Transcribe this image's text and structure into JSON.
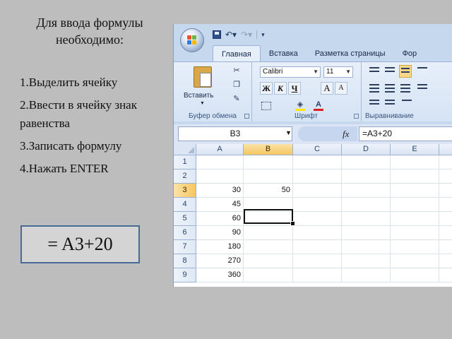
{
  "slide": {
    "title_line1": "Для ввода формулы",
    "title_line2": "необходимо:",
    "steps": [
      "1.Выделить ячейку",
      "2.Ввести  в ячейку знак равенства",
      "3.Записать формулу",
      "4.Нажать ENTER"
    ],
    "formula_example": "= A3+20"
  },
  "excel": {
    "tabs": [
      "Главная",
      "Вставка",
      "Разметка страницы",
      "Фор"
    ],
    "active_tab": "Главная",
    "clipboard": {
      "paste_label": "Вставить",
      "group_label": "Буфер обмена"
    },
    "font": {
      "font_name": "Calibri",
      "font_size": "11",
      "bold": "Ж",
      "italic": "К",
      "underline": "Ч",
      "grow": "A",
      "shrink": "A",
      "font_color": "A",
      "group_label": "Шрифт"
    },
    "alignment": {
      "group_label": "Выравнивание"
    },
    "name_box": "B3",
    "fx": "fx",
    "formula_bar": "=A3+20",
    "columns": [
      "A",
      "B",
      "C",
      "D",
      "E"
    ],
    "selected_column": "B",
    "rows": [
      {
        "num": "1",
        "A": "",
        "B": ""
      },
      {
        "num": "2",
        "A": "",
        "B": ""
      },
      {
        "num": "3",
        "A": "30",
        "B": "50"
      },
      {
        "num": "4",
        "A": "45",
        "B": ""
      },
      {
        "num": "5",
        "A": "60",
        "B": ""
      },
      {
        "num": "6",
        "A": "90",
        "B": ""
      },
      {
        "num": "7",
        "A": "180",
        "B": ""
      },
      {
        "num": "8",
        "A": "270",
        "B": ""
      },
      {
        "num": "9",
        "A": "360",
        "B": ""
      }
    ],
    "selected_row": "3",
    "active_cell": "B3",
    "colors": {
      "selection_header": "#f5c660",
      "ribbon": "#c6d8ee",
      "accent_border": "#4a6a96"
    }
  }
}
